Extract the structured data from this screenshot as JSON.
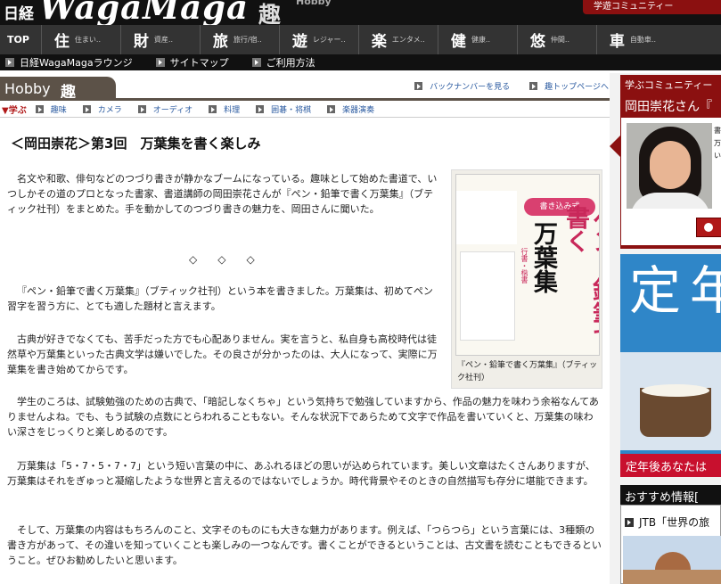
{
  "header": {
    "logo_small": "日経",
    "logo_main": "WagaMaga",
    "logo_kanji": "趣",
    "logo_hobby": "Hobby",
    "community_tab": "学遊コミュニティー"
  },
  "nav": {
    "top": "TOP",
    "items": [
      {
        "kanji": "住",
        "sub": "住まい.."
      },
      {
        "kanji": "財",
        "sub": "資産.."
      },
      {
        "kanji": "旅",
        "sub": "旅行/宿.."
      },
      {
        "kanji": "遊",
        "sub": "レジャー.."
      },
      {
        "kanji": "楽",
        "sub": "エンタメ.."
      },
      {
        "kanji": "健",
        "sub": "健康.."
      },
      {
        "kanji": "悠",
        "sub": "仲間.."
      },
      {
        "kanji": "車",
        "sub": "自動車.."
      }
    ]
  },
  "subnav": [
    "日経WagaMagaラウンジ",
    "サイトマップ",
    "ご利用方法"
  ],
  "hobby": {
    "label": "Hobby",
    "kanji": "趣",
    "links": [
      "バックナンバーを見る",
      "趣トップページへ"
    ]
  },
  "categories": {
    "label": "▼学ぶ",
    "items": [
      "趣味",
      "カメラ",
      "オーディオ",
      "料理",
      "囲碁・将棋",
      "楽器演奏"
    ]
  },
  "article": {
    "title": "＜岡田崇花＞第3回　万葉集を書く楽しみ",
    "diamonds": "◇◇◇",
    "paragraphs": [
      "名文や和歌、俳句などのつづり書きが静かなブームになっている。趣味として始めた書道で、いつしかその道のプロとなった書家、書道講師の岡田崇花さんが『ペン・鉛筆で書く万葉集』（ブティック社刊）をまとめた。手を動かしてのつづり書きの魅力を、岡田さんに聞いた。",
      "『ペン・鉛筆で書く万葉集』（ブティック社刊）という本を書きました。万葉集は、初めてペン習字を習う方に、とても適した題材と言えます。",
      "古典が好きでなくても、苦手だった方でも心配ありません。実を言うと、私自身も高校時代は徒然草や万葉集といった古典文学は嫌いでした。その良さが分かったのは、大人になって、実際に万葉集を書き始めてからです。",
      "学生のころは、試験勉強のための古典で、「暗記しなくちゃ」という気持ちで勉強していますから、作品の魅力を味わう余裕なんてありませんよね。でも、もう試験の点数にとらわれることもない。そんな状況下であらためて文字で作品を書いていくと、万葉集の味わい深さをじっくりと楽しめるのです。",
      "万葉集は「5・7・5・7・7」という短い言葉の中に、あふれるほどの思いが込められています。美しい文章はたくさんありますが、万葉集はそれをぎゅっと凝縮したような世界と言えるのではないでしょうか。時代背景やそのときの自然描写も存分に堪能できます。",
      "そして、万葉集の内容はもちろんのこと、文字そのものにも大きな魅力があります。例えば、「つらつら」という言葉には、3種類の書き方があって、その違いを知っていくことも楽しみの一つなんです。書くことができるということは、古文書を読むこともできるということ。ぜひお勧めしたいと思います。"
    ],
    "book": {
      "badge": "書き込み式",
      "title1": "ペン・鉛筆で書く",
      "title2": "万葉集",
      "subtitle": "行書・楷書",
      "caption": "『ペン・鉛筆で書く万葉集』（ブティック社刊）"
    }
  },
  "sidebar": {
    "head": "学ぶコミュニティー",
    "name": "岡田崇花さん『",
    "side_text": "書万い",
    "banner_big": "定年",
    "banner_strip": "定年後あなたは",
    "rec_head": "おすすめ情報[",
    "rec_link": "JTB「世界の旅"
  }
}
